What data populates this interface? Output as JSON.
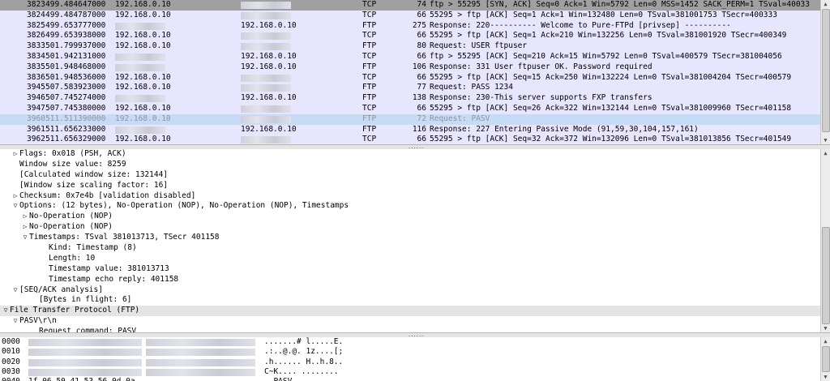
{
  "packets": [
    {
      "no": "3823",
      "time": "499.484647000",
      "src": "192.168.0.10",
      "dst": "",
      "proto": "TCP",
      "length": "74",
      "info": "ftp > 55295 [SYN, ACK] Seq=0 Ack=1 Win=5792 Len=0 MSS=1452 SACK_PERM=1 TSval=40033",
      "style": "syn",
      "dst_blur": true,
      "src_blur": false
    },
    {
      "no": "3824",
      "time": "499.484787000",
      "src": "192.168.0.10",
      "dst": "",
      "proto": "TCP",
      "length": "66",
      "info": "55295 > ftp [ACK] Seq=1 Ack=1 Win=132480 Len=0 TSval=381001753 TSecr=400333",
      "style": "tcp",
      "dst_blur": true,
      "src_blur": false
    },
    {
      "no": "3825",
      "time": "499.653777000",
      "src": "",
      "dst": "192.168.0.10",
      "proto": "FTP",
      "length": "275",
      "info": "Response: 220---------- Welcome to Pure-FTPd [privsep] ----------",
      "style": "ftp",
      "dst_blur": false,
      "src_blur": true
    },
    {
      "no": "3826",
      "time": "499.653938000",
      "src": "192.168.0.10",
      "dst": "",
      "proto": "TCP",
      "length": "66",
      "info": "55295 > ftp [ACK] Seq=1 Ack=210 Win=132256 Len=0 TSval=381001920 TSecr=400349",
      "style": "tcp",
      "dst_blur": true,
      "src_blur": false
    },
    {
      "no": "3833",
      "time": "501.799937000",
      "src": "192.168.0.10",
      "dst": "",
      "proto": "FTP",
      "length": "80",
      "info": "Request: USER ftpuser",
      "style": "ftp",
      "dst_blur": true,
      "src_blur": false
    },
    {
      "no": "3834",
      "time": "501.942131000",
      "src": "",
      "dst": "192.168.0.10",
      "proto": "TCP",
      "length": "66",
      "info": "ftp > 55295 [ACK] Seq=210 Ack=15 Win=5792 Len=0 TSval=400579 TSecr=381004056",
      "style": "tcp",
      "dst_blur": false,
      "src_blur": true
    },
    {
      "no": "3835",
      "time": "501.948468000",
      "src": "",
      "dst": "192.168.0.10",
      "proto": "FTP",
      "length": "106",
      "info": "Response: 331 User ftpuser OK. Password required",
      "style": "ftp",
      "dst_blur": false,
      "src_blur": true
    },
    {
      "no": "3836",
      "time": "501.948536000",
      "src": "192.168.0.10",
      "dst": "",
      "proto": "TCP",
      "length": "66",
      "info": "55295 > ftp [ACK] Seq=15 Ack=250 Win=132224 Len=0 TSval=381004204 TSecr=400579",
      "style": "tcp",
      "dst_blur": true,
      "src_blur": false
    },
    {
      "no": "3945",
      "time": "507.583923000",
      "src": "192.168.0.10",
      "dst": "",
      "proto": "FTP",
      "length": "77",
      "info": "Request: PASS 1234",
      "style": "ftp",
      "dst_blur": true,
      "src_blur": false
    },
    {
      "no": "3946",
      "time": "507.745274000",
      "src": "",
      "dst": "192.168.0.10",
      "proto": "FTP",
      "length": "138",
      "info": "Response: 230-This server supports FXP transfers",
      "style": "ftp",
      "dst_blur": false,
      "src_blur": true
    },
    {
      "no": "3947",
      "time": "507.745380000",
      "src": "192.168.0.10",
      "dst": "",
      "proto": "TCP",
      "length": "66",
      "info": "55295 > ftp [ACK] Seq=26 Ack=322 Win=132144 Len=0 TSval=381009960 TSecr=401158",
      "style": "tcp",
      "dst_blur": true,
      "src_blur": false
    },
    {
      "no": "3960",
      "time": "511.511390000",
      "src": "192.168.0.10",
      "dst": "",
      "proto": "FTP",
      "length": "72",
      "info": "Request: PASV",
      "style": "sel",
      "dst_blur": true,
      "src_blur": false
    },
    {
      "no": "3961",
      "time": "511.656233000",
      "src": "",
      "dst": "192.168.0.10",
      "proto": "FTP",
      "length": "116",
      "info": "Response: 227 Entering Passive Mode (91,59,30,104,157,161)",
      "style": "ftp",
      "dst_blur": false,
      "src_blur": true
    },
    {
      "no": "3962",
      "time": "511.656329000",
      "src": "192.168.0.10",
      "dst": "",
      "proto": "TCP",
      "length": "66",
      "info": "55295 > ftp [ACK] Seq=32 Ack=372 Win=132096 Len=0 TSval=381013856 TSecr=401549",
      "style": "tcp",
      "dst_blur": true,
      "src_blur": false
    }
  ],
  "details": [
    {
      "indent": 1,
      "toggle": "right",
      "text": "Flags: 0x018 (PSH, ACK)",
      "hl": false
    },
    {
      "indent": 1,
      "toggle": "",
      "text": "Window size value: 8259",
      "hl": false
    },
    {
      "indent": 1,
      "toggle": "",
      "text": "[Calculated window size: 132144]",
      "hl": false
    },
    {
      "indent": 1,
      "toggle": "",
      "text": "[Window size scaling factor: 16]",
      "hl": false
    },
    {
      "indent": 1,
      "toggle": "right",
      "text": "Checksum: 0x7e4b [validation disabled]",
      "hl": false
    },
    {
      "indent": 1,
      "toggle": "down",
      "text": "Options: (12 bytes), No-Operation (NOP), No-Operation (NOP), Timestamps",
      "hl": false
    },
    {
      "indent": 2,
      "toggle": "right",
      "text": "No-Operation (NOP)",
      "hl": false
    },
    {
      "indent": 2,
      "toggle": "right",
      "text": "No-Operation (NOP)",
      "hl": false
    },
    {
      "indent": 2,
      "toggle": "down",
      "text": "Timestamps: TSval 381013713, TSecr 401158",
      "hl": false
    },
    {
      "indent": 4,
      "toggle": "",
      "text": "Kind: Timestamp (8)",
      "hl": false
    },
    {
      "indent": 4,
      "toggle": "",
      "text": "Length: 10",
      "hl": false
    },
    {
      "indent": 4,
      "toggle": "",
      "text": "Timestamp value: 381013713",
      "hl": false
    },
    {
      "indent": 4,
      "toggle": "",
      "text": "Timestamp echo reply: 401158",
      "hl": false
    },
    {
      "indent": 1,
      "toggle": "down",
      "text": "[SEQ/ACK analysis]",
      "hl": false
    },
    {
      "indent": 3,
      "toggle": "",
      "text": "[Bytes in flight: 6]",
      "hl": false
    },
    {
      "indent": 0,
      "toggle": "down",
      "text": "File Transfer Protocol (FTP)",
      "hl": true
    },
    {
      "indent": 1,
      "toggle": "down",
      "text": "PASV\\r\\n",
      "hl": false
    },
    {
      "indent": 3,
      "toggle": "",
      "text": "Request command: PASV",
      "hl": false
    }
  ],
  "hex": [
    {
      "offset": "0000",
      "bytes": "",
      "ascii": ".......# l.....E.",
      "blur": true
    },
    {
      "offset": "0010",
      "bytes": "",
      "ascii": ".:..@.@. 1z....[;",
      "blur": true
    },
    {
      "offset": "0020",
      "bytes": "",
      "ascii": ".h...... H..h.8..",
      "blur": true
    },
    {
      "offset": "0030",
      "bytes": "",
      "ascii": " C~K.... ........",
      "blur": true
    },
    {
      "offset": "0040",
      "bytes": "1f 06 50 41 53 56 0d 0a",
      "ascii": "..PASV..",
      "blur": false
    }
  ],
  "splitter_grip": "......"
}
